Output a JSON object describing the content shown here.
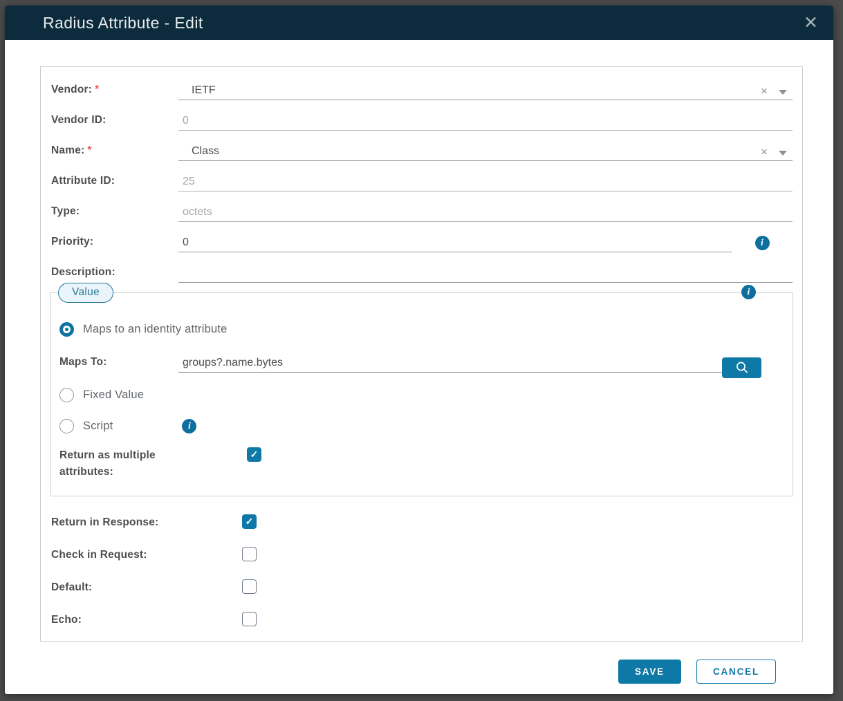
{
  "dialog": {
    "title": "Radius Attribute - Edit",
    "close_icon": "✕"
  },
  "form": {
    "required_marker": "*",
    "vendor": {
      "label": "Vendor:",
      "value": "IETF",
      "required": true,
      "disabled": false
    },
    "vendor_id": {
      "label": "Vendor ID:",
      "value": "0",
      "required": false,
      "disabled": true
    },
    "name": {
      "label": "Name:",
      "value": "Class",
      "required": true,
      "disabled": false
    },
    "attribute_id": {
      "label": "Attribute ID:",
      "value": "25",
      "required": false,
      "disabled": true
    },
    "type": {
      "label": "Type:",
      "value": "octets",
      "required": false,
      "disabled": true
    },
    "priority": {
      "label": "Priority:",
      "value": "0",
      "required": false,
      "disabled": false
    },
    "description": {
      "label": "Description:",
      "value": "",
      "required": false,
      "disabled": false
    }
  },
  "value_panel": {
    "tab_label": "Value",
    "maps_radio": {
      "label": "Maps to an identity attribute",
      "selected": true
    },
    "maps_to": {
      "label": "Maps To:",
      "value": "groups?.name.bytes"
    },
    "fixed_radio": {
      "label": "Fixed Value",
      "selected": false
    },
    "script_radio": {
      "label": "Script",
      "selected": false
    },
    "return_multiple": {
      "label": "Return as multiple attributes:",
      "checked": true
    }
  },
  "options": {
    "return_in_response": {
      "label": "Return in Response:",
      "checked": true
    },
    "check_in_request": {
      "label": "Check in Request:",
      "checked": false
    },
    "default": {
      "label": "Default:",
      "checked": false
    },
    "echo": {
      "label": "Echo:",
      "checked": false
    }
  },
  "footer": {
    "save_label": "SAVE",
    "cancel_label": "CANCEL"
  },
  "icons": {
    "info": "i",
    "check": "✓",
    "clear": "×"
  },
  "colors": {
    "primary": "#0e78a7",
    "header_bg": "#0c2b3d",
    "required": "#e45b57",
    "chip_bg": "#e9f4fb",
    "chip_border": "#28799c"
  }
}
